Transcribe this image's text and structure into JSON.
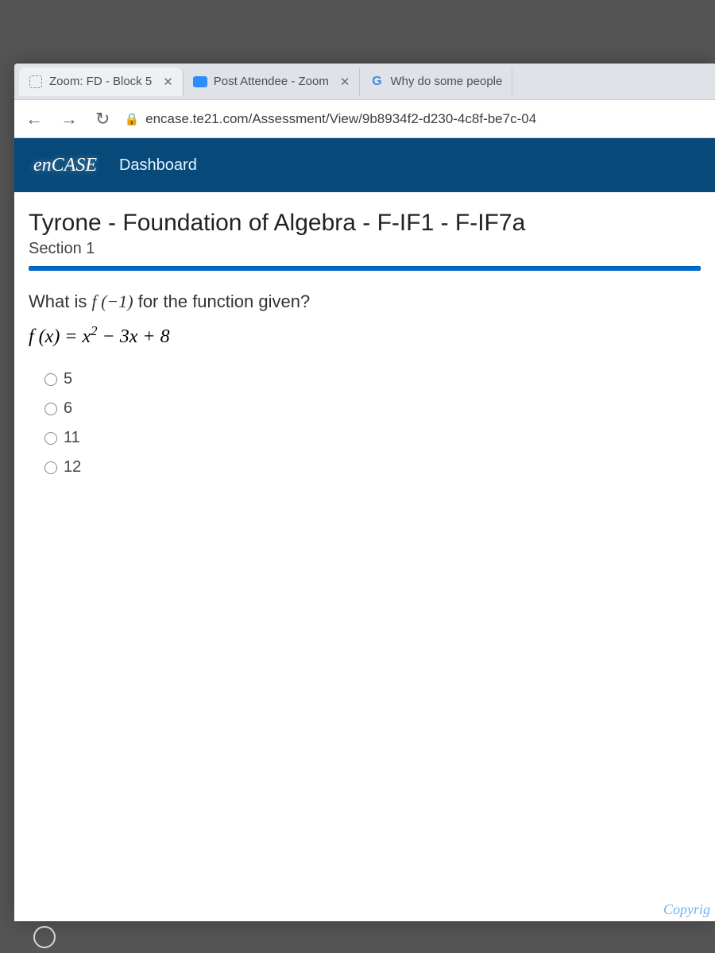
{
  "tabs": [
    {
      "title": "Zoom: FD - Block 5",
      "icon": "zoom"
    },
    {
      "title": "Post Attendee - Zoom",
      "icon": "video"
    },
    {
      "title": "Why do some people",
      "icon": "google"
    }
  ],
  "toolbar": {
    "url": "encase.te21.com/Assessment/View/9b8934f2-d230-4c8f-be7c-04"
  },
  "app": {
    "logo": "CASE",
    "nav_dashboard": "Dashboard"
  },
  "assessment": {
    "title": "Tyrone - Foundation of Algebra - F-IF1 - F-IF7a",
    "section": "Section 1",
    "question_prefix": "What is ",
    "question_math": "f (−1)",
    "question_suffix": " for the function given?",
    "formula_lhs": "f (x) = x",
    "formula_exp": "2",
    "formula_rhs": " − 3x + 8",
    "options": [
      "5",
      "6",
      "11",
      "12"
    ]
  },
  "footer": {
    "copyright": "Copyrig"
  }
}
